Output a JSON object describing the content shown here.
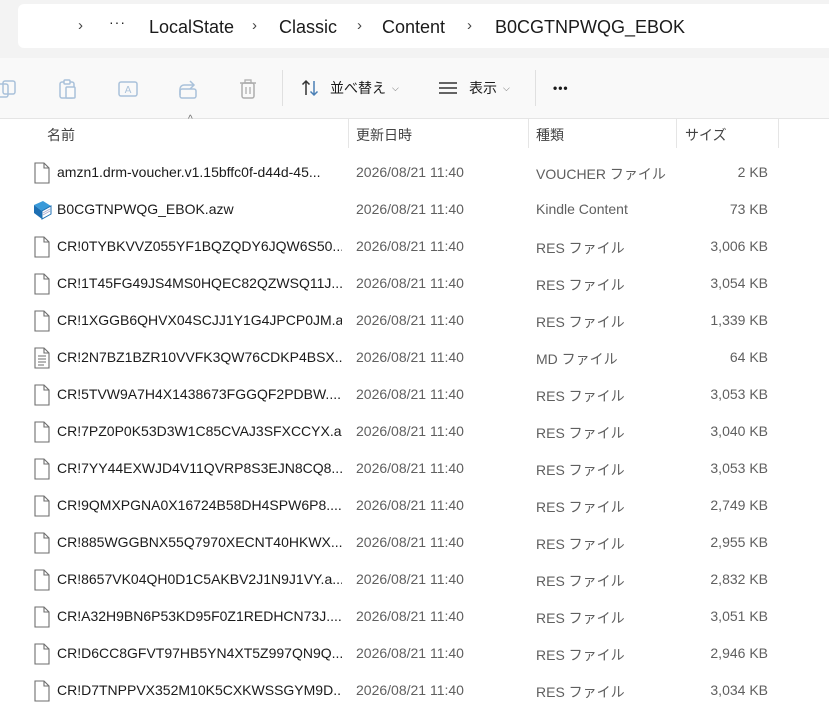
{
  "breadcrumb": {
    "segments": [
      "LocalState",
      "Classic",
      "Content",
      "B0CGTNPWQG_EBOK"
    ],
    "overflow": "···"
  },
  "toolbar": {
    "sort_label": "並べ替え",
    "view_label": "表示",
    "more_label": "•••"
  },
  "columns": {
    "name": "名前",
    "date": "更新日時",
    "type": "種類",
    "size": "サイズ"
  },
  "files": [
    {
      "name": "amzn1.drm-voucher.v1.15bffc0f-d44d-45...",
      "date": "2026/08/21 11:40",
      "type": "VOUCHER ファイル",
      "size": "2 KB",
      "icon": "file-icon"
    },
    {
      "name": "B0CGTNPWQG_EBOK.azw",
      "date": "2026/08/21 11:40",
      "type": "Kindle Content",
      "size": "73 KB",
      "icon": "kindle-book-icon"
    },
    {
      "name": "CR!0TYBKVVZ055YF1BQZQDY6JQW6S50....",
      "date": "2026/08/21 11:40",
      "type": "RES ファイル",
      "size": "3,006 KB",
      "icon": "file-icon"
    },
    {
      "name": "CR!1T45FG49JS4MS0HQEC82QZWSQ11J....",
      "date": "2026/08/21 11:40",
      "type": "RES ファイル",
      "size": "3,054 KB",
      "icon": "file-icon"
    },
    {
      "name": "CR!1XGGB6QHVX04SCJJ1Y1G4JPCP0JM.a...",
      "date": "2026/08/21 11:40",
      "type": "RES ファイル",
      "size": "1,339 KB",
      "icon": "file-icon"
    },
    {
      "name": "CR!2N7BZ1BZR10VVFK3QW76CDKP4BSX....",
      "date": "2026/08/21 11:40",
      "type": "MD ファイル",
      "size": "64 KB",
      "icon": "text-file-icon"
    },
    {
      "name": "CR!5TVW9A7H4X1438673FGGQF2PDBW....",
      "date": "2026/08/21 11:40",
      "type": "RES ファイル",
      "size": "3,053 KB",
      "icon": "file-icon"
    },
    {
      "name": "CR!7PZ0P0K53D3W1C85CVAJ3SFXCCYX.a...",
      "date": "2026/08/21 11:40",
      "type": "RES ファイル",
      "size": "3,040 KB",
      "icon": "file-icon"
    },
    {
      "name": "CR!7YY44EXWJD4V11QVRP8S3EJN8CQ8....",
      "date": "2026/08/21 11:40",
      "type": "RES ファイル",
      "size": "3,053 KB",
      "icon": "file-icon"
    },
    {
      "name": "CR!9QMXPGNA0X16724B58DH4SPW6P8....",
      "date": "2026/08/21 11:40",
      "type": "RES ファイル",
      "size": "2,749 KB",
      "icon": "file-icon"
    },
    {
      "name": "CR!885WGGBNX55Q7970XECNT40HKWX....",
      "date": "2026/08/21 11:40",
      "type": "RES ファイル",
      "size": "2,955 KB",
      "icon": "file-icon"
    },
    {
      "name": "CR!8657VK04QH0D1C5AKBV2J1N9J1VY.a...",
      "date": "2026/08/21 11:40",
      "type": "RES ファイル",
      "size": "2,832 KB",
      "icon": "file-icon"
    },
    {
      "name": "CR!A32H9BN6P53KD95F0Z1REDHCN73J....",
      "date": "2026/08/21 11:40",
      "type": "RES ファイル",
      "size": "3,051 KB",
      "icon": "file-icon"
    },
    {
      "name": "CR!D6CC8GFVT97HB5YN4XT5Z997QN9Q....",
      "date": "2026/08/21 11:40",
      "type": "RES ファイル",
      "size": "2,946 KB",
      "icon": "file-icon"
    },
    {
      "name": "CR!D7TNPPVX352M10K5CXKWSSGYM9D....",
      "date": "2026/08/21 11:40",
      "type": "RES ファイル",
      "size": "3,034 KB",
      "icon": "file-icon"
    }
  ]
}
